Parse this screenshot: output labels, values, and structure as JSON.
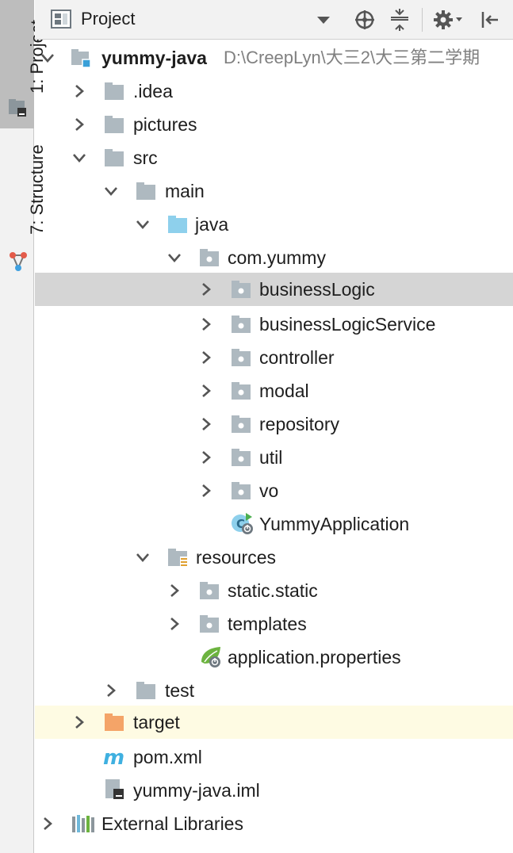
{
  "left_strip": {
    "project_tab": "1: Project",
    "structure_tab": "7: Structure"
  },
  "header": {
    "title": "Project",
    "view_icon": "project-view-icon",
    "buttons": [
      "dropdown-arrow-icon",
      "locate-icon",
      "collapse-all-icon",
      "settings-icon",
      "hide-icon"
    ]
  },
  "tree": {
    "rows": [
      {
        "label": "yummy-java",
        "path": "D:\\CreepLyn\\大三2\\大三第二学期",
        "icon": "module-folder-icon",
        "expanded": true
      },
      {
        "label": ".idea",
        "icon": "folder-icon",
        "expanded": false
      },
      {
        "label": "pictures",
        "icon": "folder-icon",
        "expanded": false
      },
      {
        "label": "src",
        "icon": "folder-icon",
        "expanded": true
      },
      {
        "label": "main",
        "icon": "folder-icon",
        "expanded": true
      },
      {
        "label": "java",
        "icon": "source-folder-icon",
        "expanded": true
      },
      {
        "label": "com.yummy",
        "icon": "package-icon",
        "expanded": true
      },
      {
        "label": "businessLogic",
        "icon": "package-icon",
        "expanded": false,
        "selected": true
      },
      {
        "label": "businessLogicService",
        "icon": "package-icon",
        "expanded": false
      },
      {
        "label": "controller",
        "icon": "package-icon",
        "expanded": false
      },
      {
        "label": "modal",
        "icon": "package-icon",
        "expanded": false
      },
      {
        "label": "repository",
        "icon": "package-icon",
        "expanded": false
      },
      {
        "label": "util",
        "icon": "package-icon",
        "expanded": false
      },
      {
        "label": "vo",
        "icon": "package-icon",
        "expanded": false
      },
      {
        "label": "YummyApplication",
        "icon": "spring-boot-class-icon"
      },
      {
        "label": "resources",
        "icon": "resources-folder-icon",
        "expanded": true
      },
      {
        "label": "static.static",
        "icon": "package-icon",
        "expanded": false
      },
      {
        "label": "templates",
        "icon": "package-icon",
        "expanded": false
      },
      {
        "label": "application.properties",
        "icon": "spring-properties-icon"
      },
      {
        "label": "test",
        "icon": "folder-icon",
        "expanded": false
      },
      {
        "label": "target",
        "icon": "excluded-folder-icon",
        "expanded": false,
        "excluded": true
      },
      {
        "label": "pom.xml",
        "icon": "maven-icon"
      },
      {
        "label": "yummy-java.iml",
        "icon": "iml-file-icon"
      },
      {
        "label": "External Libraries",
        "icon": "libraries-icon",
        "expanded": false
      }
    ]
  },
  "colors": {
    "selected_row": "#d5d5d5",
    "excluded_row": "#fefbe3",
    "folder": "#aeb9c0",
    "source_folder": "#8ed0ec",
    "excluded_folder": "#f4a468",
    "maven_blue": "#3fb0e0",
    "spring_green": "#6cb33f"
  }
}
